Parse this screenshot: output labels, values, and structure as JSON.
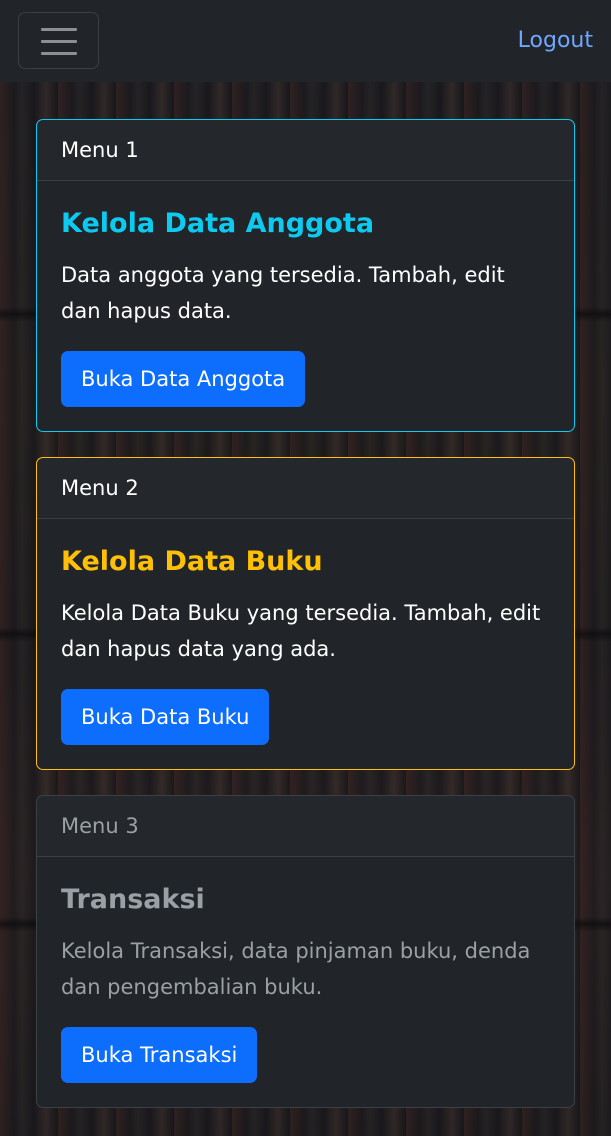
{
  "navbar": {
    "toggle_icon": "hamburger-menu-icon",
    "logout_label": "Logout",
    "logout_color": "#6ea8fe"
  },
  "cards": [
    {
      "header": "Menu 1",
      "title": "Kelola Data Anggota",
      "text": "Data anggota yang tersedia. Tambah, edit dan hapus data.",
      "button_label": "Buka Data Anggota",
      "accent": "#0dcaf0"
    },
    {
      "header": "Menu 2",
      "title": "Kelola Data Buku",
      "text": "Kelola Data Buku yang tersedia. Tambah, edit dan hapus data yang ada.",
      "button_label": "Buka Data Buku",
      "accent": "#ffc107"
    },
    {
      "header": "Menu 3",
      "title": "Transaksi",
      "text": "Kelola Transaksi, data pinjaman buku, denda dan pengembalian buku.",
      "button_label": "Buka Transaksi",
      "accent": "#9aa0a6"
    }
  ],
  "colors": {
    "navbar_bg": "#212529",
    "card_bg": "#212529",
    "button_bg": "#0d6efd"
  }
}
